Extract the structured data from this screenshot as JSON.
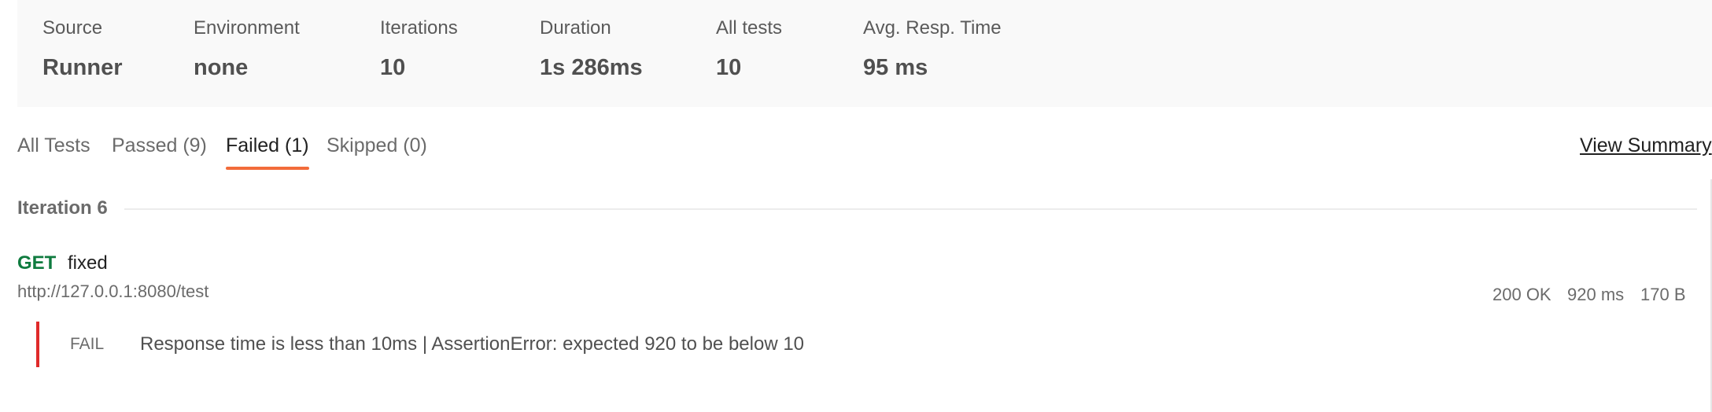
{
  "summary": {
    "source": {
      "label": "Source",
      "value": "Runner"
    },
    "environment": {
      "label": "Environment",
      "value": "none"
    },
    "iterations": {
      "label": "Iterations",
      "value": "10"
    },
    "duration": {
      "label": "Duration",
      "value": "1s 286ms"
    },
    "all_tests": {
      "label": "All tests",
      "value": "10"
    },
    "avg_resp_time": {
      "label": "Avg. Resp. Time",
      "value": "95 ms"
    }
  },
  "tabs": [
    {
      "label": "All Tests",
      "active": false
    },
    {
      "label": "Passed (9)",
      "active": false
    },
    {
      "label": "Failed (1)",
      "active": true
    },
    {
      "label": "Skipped (0)",
      "active": false
    }
  ],
  "view_summary_label": "View Summary",
  "iteration": {
    "title": "Iteration 6",
    "request": {
      "method": "GET",
      "name": "fixed",
      "url": "http://127.0.0.1:8080/test",
      "status": "200 OK",
      "time": "920 ms",
      "size": "170 B"
    },
    "result": {
      "tag": "FAIL",
      "message": "Response time is less than 10ms | AssertionError: expected 920 to be below 10"
    }
  },
  "colors": {
    "accent": "#f26b3a",
    "method_get": "#0f7b3f",
    "fail": "#e02a2a",
    "summary_bg": "#f9f9f9"
  }
}
